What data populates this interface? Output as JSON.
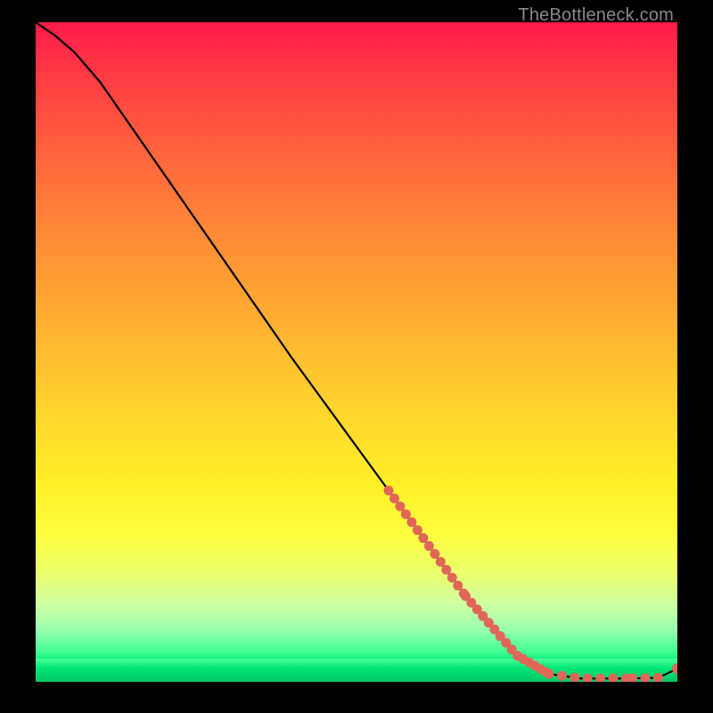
{
  "attribution": "TheBottleneck.com",
  "chart_data": {
    "type": "line",
    "title": "",
    "xlabel": "",
    "ylabel": "",
    "xlim": [
      0,
      100
    ],
    "ylim": [
      0,
      100
    ],
    "grid": false,
    "legend": false,
    "curve": [
      {
        "x": 0,
        "y": 100
      },
      {
        "x": 3,
        "y": 98
      },
      {
        "x": 6,
        "y": 95.5
      },
      {
        "x": 10,
        "y": 91
      },
      {
        "x": 15,
        "y": 84
      },
      {
        "x": 25,
        "y": 70
      },
      {
        "x": 40,
        "y": 49
      },
      {
        "x": 55,
        "y": 29
      },
      {
        "x": 67,
        "y": 13
      },
      {
        "x": 75,
        "y": 4
      },
      {
        "x": 80,
        "y": 1.2
      },
      {
        "x": 85,
        "y": 0.5
      },
      {
        "x": 92,
        "y": 0.5
      },
      {
        "x": 97,
        "y": 0.6
      },
      {
        "x": 100,
        "y": 2.0
      }
    ],
    "marker_ranges": [
      {
        "x_start": 55,
        "x_end": 67,
        "dense": true
      },
      {
        "x_start": 67,
        "x_end": 80,
        "dense": true
      },
      {
        "x_start": 80,
        "x_end": 92,
        "dense": false
      },
      {
        "x_start": 93,
        "x_end": 97,
        "dense": false
      }
    ],
    "end_marker": {
      "x": 100,
      "y": 2.0
    },
    "marker_color": "#e06758",
    "curve_color": "#000000"
  },
  "colors": {
    "background": "#000000",
    "attribution_text": "#888888"
  }
}
